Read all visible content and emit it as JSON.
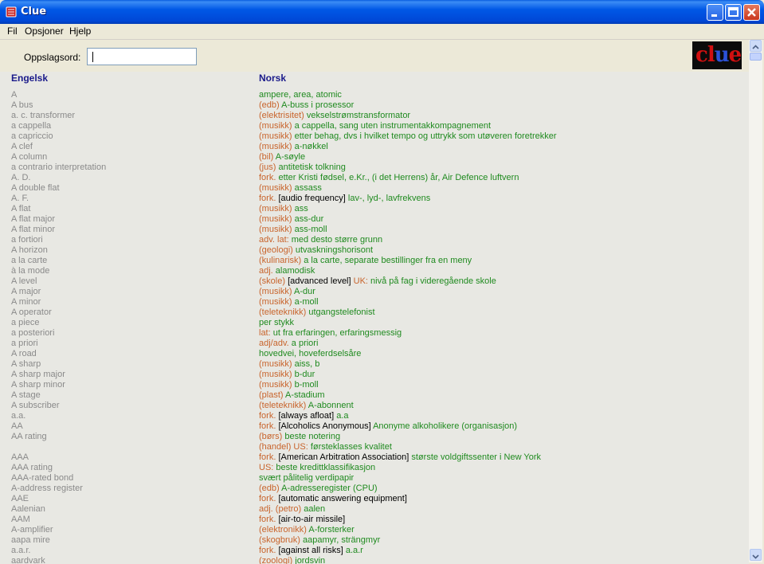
{
  "window": {
    "title": "Clue"
  },
  "menu": [
    "Fil",
    "Opsjoner",
    "Hjelp"
  ],
  "search": {
    "label": "Oppslagsord:",
    "value": ""
  },
  "logo": {
    "text_a": "cl",
    "text_b": "u",
    "text_c": "e"
  },
  "columns": {
    "left": "Engelsk",
    "right": "Norsk"
  },
  "colors": {
    "category": "#c8642c",
    "translation": "#1f8a1f",
    "term": "#8a8a8a",
    "header": "#1a1a8a"
  },
  "entries": [
    {
      "en": "A",
      "no": [
        [
          "g",
          "ampere, area, atomic"
        ]
      ]
    },
    {
      "en": "A bus",
      "no": [
        [
          "c",
          "(edb) "
        ],
        [
          "g",
          "A-buss i prosessor"
        ]
      ]
    },
    {
      "en": "a. c. transformer",
      "no": [
        [
          "c",
          "(elektrisitet) "
        ],
        [
          "g",
          "vekselstrømstransformator"
        ]
      ]
    },
    {
      "en": "a cappella",
      "no": [
        [
          "c",
          "(musikk) "
        ],
        [
          "g",
          "a cappella, sang uten instrumentakkompagnement"
        ]
      ]
    },
    {
      "en": "a capriccio",
      "no": [
        [
          "c",
          "(musikk) "
        ],
        [
          "g",
          "etter behag, dvs i hvilket tempo og uttrykk som utøveren foretrekker"
        ]
      ]
    },
    {
      "en": "A clef",
      "no": [
        [
          "c",
          "(musikk) "
        ],
        [
          "g",
          "a-nøkkel"
        ]
      ]
    },
    {
      "en": "A column",
      "no": [
        [
          "c",
          "(bil) "
        ],
        [
          "g",
          "A-søyle"
        ]
      ]
    },
    {
      "en": "a contrario interpretation",
      "no": [
        [
          "c",
          "(jus) "
        ],
        [
          "g",
          "antitetisk tolkning"
        ]
      ]
    },
    {
      "en": "A. D.",
      "no": [
        [
          "c",
          "fork. "
        ],
        [
          "g",
          "etter Kristi fødsel, e.Kr., (i det Herrens) år, Air Defence luftvern"
        ]
      ]
    },
    {
      "en": "A double flat",
      "no": [
        [
          "c",
          "(musikk) "
        ],
        [
          "g",
          "assass"
        ]
      ]
    },
    {
      "en": "A. F.",
      "no": [
        [
          "c",
          "fork. "
        ],
        [
          "b",
          "[audio frequency] "
        ],
        [
          "g",
          "lav-, lyd-, lavfrekvens"
        ]
      ]
    },
    {
      "en": "A flat",
      "no": [
        [
          "c",
          "(musikk) "
        ],
        [
          "g",
          "ass"
        ]
      ]
    },
    {
      "en": "A flat major",
      "no": [
        [
          "c",
          "(musikk) "
        ],
        [
          "g",
          "ass-dur"
        ]
      ]
    },
    {
      "en": "A flat minor",
      "no": [
        [
          "c",
          "(musikk) "
        ],
        [
          "g",
          "ass-moll"
        ]
      ]
    },
    {
      "en": "a fortiori",
      "no": [
        [
          "c",
          "adv. lat: "
        ],
        [
          "g",
          "med desto større grunn"
        ]
      ]
    },
    {
      "en": "A horizon",
      "no": [
        [
          "c",
          "(geologi) "
        ],
        [
          "g",
          "utvaskningshorisont"
        ]
      ]
    },
    {
      "en": "a la carte",
      "no": [
        [
          "c",
          "(kulinarisk) "
        ],
        [
          "g",
          "a la carte, separate bestillinger fra en meny"
        ]
      ]
    },
    {
      "en": "à la mode",
      "no": [
        [
          "c",
          "adj. "
        ],
        [
          "g",
          "alamodisk"
        ]
      ]
    },
    {
      "en": "A level",
      "no": [
        [
          "c",
          "(skole) "
        ],
        [
          "b",
          "[advanced level] "
        ],
        [
          "c",
          "UK: "
        ],
        [
          "g",
          "nivå på fag i videregående skole"
        ]
      ]
    },
    {
      "en": "A major",
      "no": [
        [
          "c",
          "(musikk) "
        ],
        [
          "g",
          "A-dur"
        ]
      ]
    },
    {
      "en": "A minor",
      "no": [
        [
          "c",
          "(musikk) "
        ],
        [
          "g",
          "a-moll"
        ]
      ]
    },
    {
      "en": "A operator",
      "no": [
        [
          "c",
          "(teleteknikk) "
        ],
        [
          "g",
          "utgangstelefonist"
        ]
      ]
    },
    {
      "en": "a piece",
      "no": [
        [
          "g",
          "per stykk"
        ]
      ]
    },
    {
      "en": "a posteriori",
      "no": [
        [
          "c",
          "lat: "
        ],
        [
          "g",
          "ut fra erfaringen, erfaringsmessig"
        ]
      ]
    },
    {
      "en": "a priori",
      "no": [
        [
          "c",
          "adj/adv. "
        ],
        [
          "g",
          "a priori"
        ]
      ]
    },
    {
      "en": "A road",
      "no": [
        [
          "g",
          "hovedvei, hoveferdselsåre"
        ]
      ]
    },
    {
      "en": "A sharp",
      "no": [
        [
          "c",
          "(musikk) "
        ],
        [
          "g",
          "aiss, b"
        ]
      ]
    },
    {
      "en": "A sharp major",
      "no": [
        [
          "c",
          "(musikk) "
        ],
        [
          "g",
          "b-dur"
        ]
      ]
    },
    {
      "en": "A sharp minor",
      "no": [
        [
          "c",
          "(musikk) "
        ],
        [
          "g",
          "b-moll"
        ]
      ]
    },
    {
      "en": "A stage",
      "no": [
        [
          "c",
          "(plast) "
        ],
        [
          "g",
          "A-stadium"
        ]
      ]
    },
    {
      "en": "A subscriber",
      "no": [
        [
          "c",
          "(teleteknikk) "
        ],
        [
          "g",
          "A-abonnent"
        ]
      ]
    },
    {
      "en": "a.a.",
      "no": [
        [
          "c",
          "fork. "
        ],
        [
          "b",
          "[always afloat] "
        ],
        [
          "g",
          "a.a"
        ]
      ]
    },
    {
      "en": "AA",
      "no": [
        [
          "c",
          "fork. "
        ],
        [
          "b",
          "[Alcoholics Anonymous] "
        ],
        [
          "g",
          "Anonyme alkoholikere (organisasjon)"
        ]
      ]
    },
    {
      "en": "AA rating",
      "no": [
        [
          "c",
          "(børs) "
        ],
        [
          "g",
          "beste notering"
        ]
      ]
    },
    {
      "en": "",
      "no": [
        [
          "c",
          "(handel) US: "
        ],
        [
          "g",
          "førsteklasses kvalitet"
        ]
      ]
    },
    {
      "en": "AAA",
      "no": [
        [
          "c",
          "fork. "
        ],
        [
          "b",
          "[American Arbitration Association] "
        ],
        [
          "g",
          "største voldgiftssenter i New York"
        ]
      ]
    },
    {
      "en": "AAA rating",
      "no": [
        [
          "c",
          "US: "
        ],
        [
          "g",
          "beste kredittklassifikasjon"
        ]
      ]
    },
    {
      "en": "AAA-rated bond",
      "no": [
        [
          "g",
          "svært pålitelig verdipapir"
        ]
      ]
    },
    {
      "en": "A-address register",
      "no": [
        [
          "c",
          "(edb) "
        ],
        [
          "g",
          "A-adresseregister (CPU)"
        ]
      ]
    },
    {
      "en": "AAE",
      "no": [
        [
          "c",
          "fork. "
        ],
        [
          "b",
          "[automatic answering equipment]"
        ]
      ]
    },
    {
      "en": "Aalenian",
      "no": [
        [
          "c",
          "adj. (petro) "
        ],
        [
          "g",
          "aalen"
        ]
      ]
    },
    {
      "en": "AAM",
      "no": [
        [
          "c",
          "fork. "
        ],
        [
          "b",
          "[air-to-air missile]"
        ]
      ]
    },
    {
      "en": "A-amplifier",
      "no": [
        [
          "c",
          "(elektronikk) "
        ],
        [
          "g",
          "A-forsterker"
        ]
      ]
    },
    {
      "en": "aapa mire",
      "no": [
        [
          "c",
          "(skogbruk) "
        ],
        [
          "g",
          "aapamyr, strängmyr"
        ]
      ]
    },
    {
      "en": "a.a.r.",
      "no": [
        [
          "c",
          "fork. "
        ],
        [
          "b",
          "[against all risks] "
        ],
        [
          "g",
          "a.a.r"
        ]
      ]
    },
    {
      "en": "aardvark",
      "no": [
        [
          "c",
          "(zoologi) "
        ],
        [
          "g",
          "jordsvin"
        ]
      ]
    }
  ]
}
